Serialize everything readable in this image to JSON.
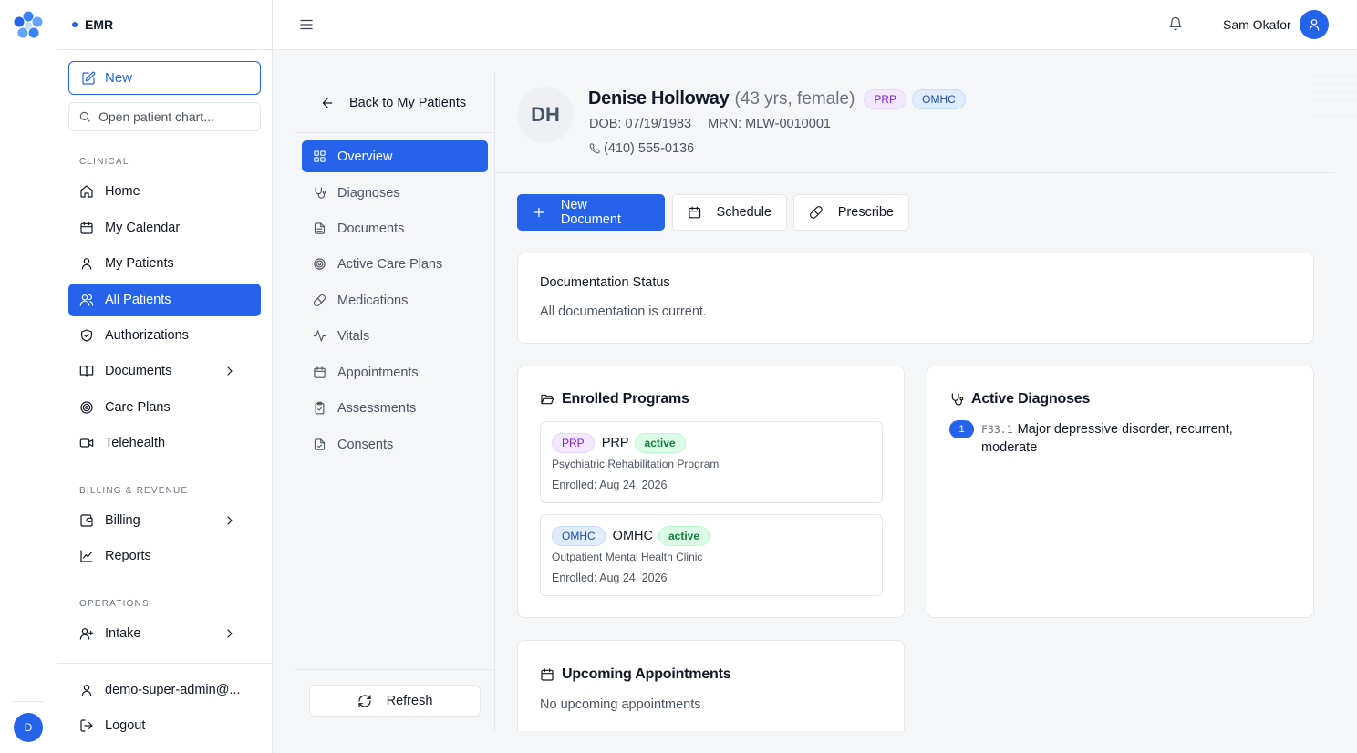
{
  "app": {
    "name": "EMR"
  },
  "sidebar": {
    "new_label": "New",
    "search_placeholder": "Open patient chart...",
    "sections": {
      "clinical": "CLINICAL",
      "billing": "BILLING & REVENUE",
      "operations": "OPERATIONS"
    },
    "items": {
      "home": "Home",
      "calendar": "My Calendar",
      "my_patients": "My Patients",
      "all_patients": "All Patients",
      "authorizations": "Authorizations",
      "documents": "Documents",
      "care_plans": "Care Plans",
      "telehealth": "Telehealth",
      "billing": "Billing",
      "reports": "Reports",
      "intake": "Intake"
    },
    "account": "demo-super-admin@...",
    "logout": "Logout",
    "rail_avatar": "D"
  },
  "header": {
    "user_name": "Sam Okafor"
  },
  "patient_nav": {
    "back": "Back to My Patients",
    "items": [
      "Overview",
      "Diagnoses",
      "Documents",
      "Active Care Plans",
      "Medications",
      "Vitals",
      "Appointments",
      "Assessments",
      "Consents"
    ],
    "refresh": "Refresh"
  },
  "patient": {
    "initials": "DH",
    "name": "Denise Holloway",
    "age_sex": "(43 yrs, female)",
    "tags": [
      "PRP",
      "OMHC"
    ],
    "dob": "DOB: 07/19/1983",
    "mrn": "MRN: MLW-0010001",
    "phone": "(410) 555-0136"
  },
  "actions": {
    "new_document": "New Document",
    "schedule": "Schedule",
    "prescribe": "Prescribe"
  },
  "documentation": {
    "title": "Documentation Status",
    "text": "All documentation is current."
  },
  "programs": {
    "title": "Enrolled Programs",
    "items": [
      {
        "tag": "PRP",
        "name": "PRP",
        "status": "active",
        "desc": "Psychiatric Rehabilitation Program",
        "enrolled": "Enrolled: Aug 24, 2026"
      },
      {
        "tag": "OMHC",
        "name": "OMHC",
        "status": "active",
        "desc": "Outpatient Mental Health Clinic",
        "enrolled": "Enrolled: Aug 24, 2026"
      }
    ]
  },
  "diagnoses": {
    "title": "Active Diagnoses",
    "items": [
      {
        "rank": "1",
        "code": "F33.1",
        "desc": "Major depressive disorder, recurrent, moderate"
      }
    ]
  },
  "appointments": {
    "title": "Upcoming Appointments",
    "empty": "No upcoming appointments"
  },
  "colors": {
    "primary": "#2563eb",
    "prp_bg": "#f3e8ff",
    "omhc_bg": "#e0ecff",
    "active_bg": "#dcfce7"
  }
}
